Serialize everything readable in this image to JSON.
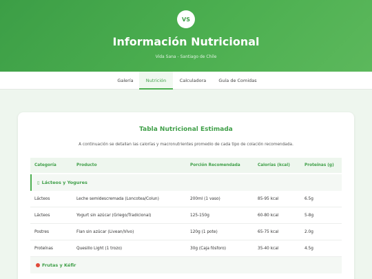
{
  "header": {
    "logo_text": "VS",
    "title": "Información Nutricional",
    "subtitle": "Vida Sana - Santiago de Chile"
  },
  "nav": {
    "items": [
      "Galería",
      "Nutrición",
      "Calculadora",
      "Guía de Comidas"
    ],
    "active": "Nutrición"
  },
  "section": {
    "title": "Tabla Nutricional Estimada",
    "description": "A continuación se detallan las calorías y macronutrientes promedio de cada tipo de colación recomendada."
  },
  "table": {
    "columns": [
      "Categoría",
      "Producto",
      "Porción Recomendada",
      "Calorías (kcal)",
      "Proteínas (g)"
    ],
    "groups": [
      {
        "label": "Lácteos y Yogures",
        "icon": "milk-icon",
        "rows": [
          [
            "Lácteos",
            "Leche semidescremada (Loncotea/Colun)",
            "200ml (1 vaso)",
            "85-95 kcal",
            "6.5g"
          ],
          [
            "Lácteos",
            "Yogurt sin azúcar (Griego/Tradicional)",
            "125-150g",
            "60-80 kcal",
            "5-8g"
          ],
          [
            "Postres",
            "Flan sin azúcar (Livean/Vivo)",
            "120g (1 pote)",
            "65-75 kcal",
            "2.0g"
          ],
          [
            "Proteínas",
            "Quesillo Light (1 trozo)",
            "30g (Caja fósforo)",
            "35-40 kcal",
            "4.5g"
          ]
        ]
      },
      {
        "label": "Frutas y Kéfir",
        "icon": "apple-icon",
        "rows": []
      }
    ]
  },
  "colors": {
    "primary": "#4caf50",
    "primary_dark": "#3f9f48",
    "background": "#eef6ee"
  }
}
